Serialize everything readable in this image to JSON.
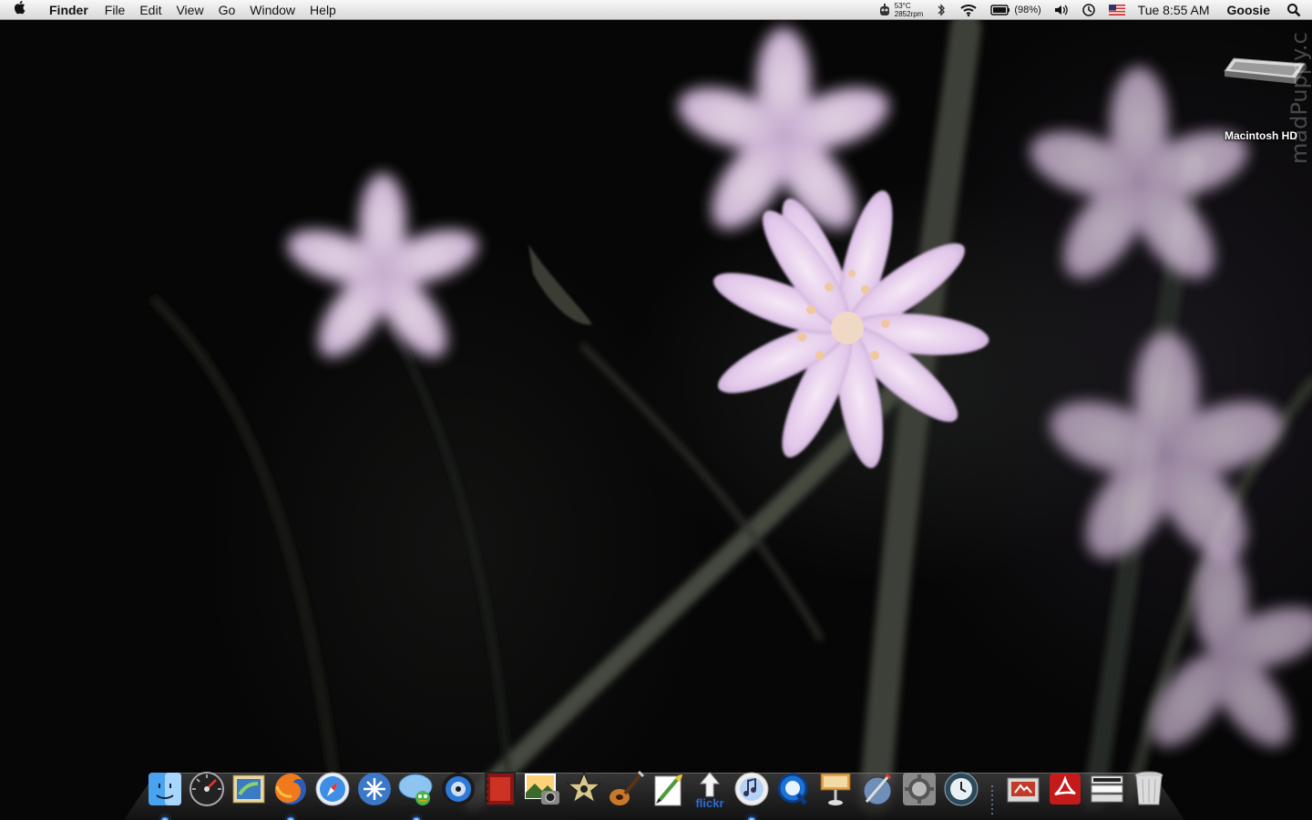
{
  "menubar": {
    "apple_menu": "",
    "app_name": "Finder",
    "menus": [
      "File",
      "Edit",
      "View",
      "Go",
      "Window",
      "Help"
    ],
    "status": {
      "temperature": "53°C",
      "fan_speed": "2852rpm",
      "battery": "(98%)",
      "clock": "Tue 8:55 AM",
      "user": "Goosie"
    }
  },
  "desktop": {
    "hd_label": "Macintosh HD",
    "watermark": "madPuppy.c"
  },
  "dock": {
    "apps": [
      {
        "name": "finder-dock-icon",
        "running": true
      },
      {
        "name": "dashboard-dock-icon",
        "running": false
      },
      {
        "name": "mail-dock-icon",
        "running": false
      },
      {
        "name": "firefox-dock-icon",
        "running": true
      },
      {
        "name": "safari-dock-icon",
        "running": false
      },
      {
        "name": "transmission-dock-icon",
        "running": false
      },
      {
        "name": "adium-dock-icon",
        "running": true
      },
      {
        "name": "dvd-player-dock-icon",
        "running": false
      },
      {
        "name": "imovie-dock-icon",
        "running": false
      },
      {
        "name": "iphoto-dock-icon",
        "running": false
      },
      {
        "name": "imovie-star-dock-icon",
        "running": false
      },
      {
        "name": "garageband-dock-icon",
        "running": false
      },
      {
        "name": "iweb-dock-icon",
        "running": false
      },
      {
        "name": "flickr-uploadr-dock-icon",
        "running": false
      },
      {
        "name": "itunes-dock-icon",
        "running": true
      },
      {
        "name": "quicktime-dock-icon",
        "running": false
      },
      {
        "name": "keynote-dock-icon",
        "running": false
      },
      {
        "name": "script-editor-dock-icon",
        "running": false
      },
      {
        "name": "system-preferences-dock-icon",
        "running": false
      },
      {
        "name": "time-machine-dock-icon",
        "running": false
      }
    ],
    "docs": [
      {
        "name": "documents-stack-icon"
      },
      {
        "name": "acrobat-stack-icon"
      },
      {
        "name": "downloads-stack-icon"
      },
      {
        "name": "trash-icon"
      }
    ],
    "flickr_text": "flickr"
  }
}
